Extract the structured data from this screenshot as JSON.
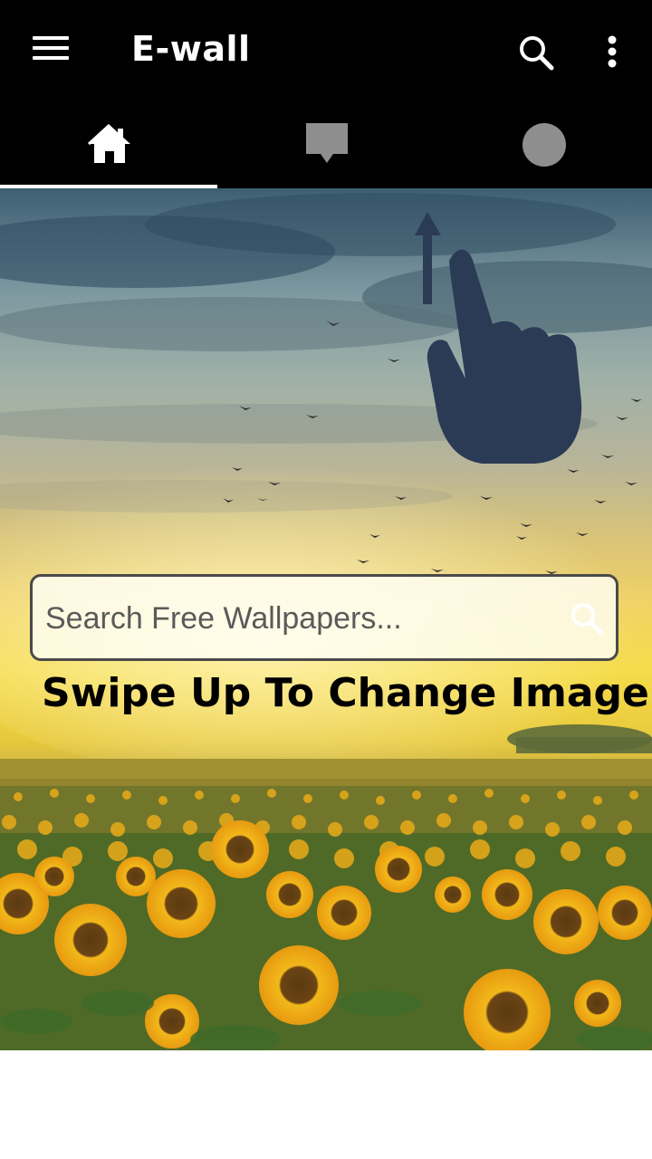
{
  "appbar": {
    "title": "E-wall",
    "icons": [
      "menu-icon",
      "search-icon",
      "more-vert-icon"
    ]
  },
  "tabs": [
    {
      "icon": "home-icon",
      "selected": true
    },
    {
      "icon": "chat-bubble-icon",
      "selected": false
    },
    {
      "icon": "circle-icon",
      "selected": false
    }
  ],
  "search": {
    "placeholder": "Search Free Wallpapers...",
    "value": ""
  },
  "hint": {
    "swipe_text": "Swipe Up To Change Image"
  },
  "colors": {
    "appbar_bg": "#000000",
    "tab_indicator": "#ffffff",
    "hand_icon": "#2b3a55"
  }
}
